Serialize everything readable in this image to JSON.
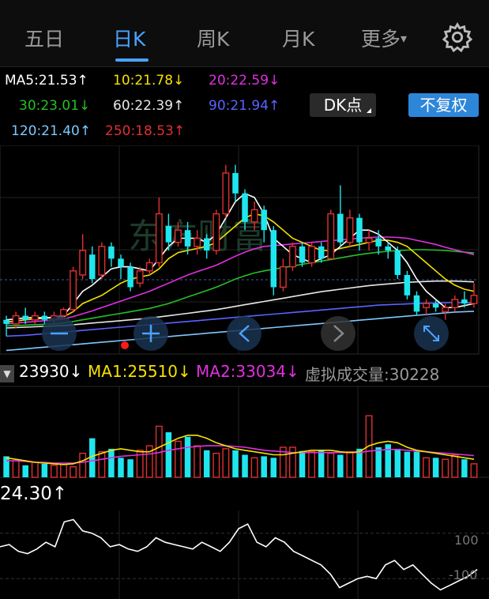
{
  "tabs": [
    {
      "label": "五日",
      "active": false
    },
    {
      "label": "日K",
      "active": true
    },
    {
      "label": "周K",
      "active": false
    },
    {
      "label": "月K",
      "active": false
    },
    {
      "label": "更多",
      "active": false
    }
  ],
  "more_arrow": "▾",
  "ma": {
    "ma5": {
      "text": "MA5:21.53",
      "arrow": "↑",
      "color": "#ffffff"
    },
    "ma10": {
      "text": "10:21.78",
      "arrow": "↓",
      "color": "#f5e200"
    },
    "ma20": {
      "text": "20:22.59",
      "arrow": "↓",
      "color": "#e030e0"
    },
    "ma30": {
      "text": "30:23.01",
      "arrow": "↓",
      "color": "#25c025"
    },
    "ma60": {
      "text": "60:22.39",
      "arrow": "↑",
      "color": "#e8e8e8"
    },
    "ma90": {
      "text": "90:21.94",
      "arrow": "↑",
      "color": "#5a63ff"
    },
    "ma120": {
      "text": "120:21.40",
      "arrow": "↑",
      "color": "#7ec8ff"
    },
    "ma250": {
      "text": "250:18.53",
      "arrow": "↑",
      "color": "#e03030"
    }
  },
  "buttons": {
    "dk_label": "DK点",
    "fuquan_label": "不复权"
  },
  "volume": {
    "vol": "23930",
    "vol_arrow": "↓",
    "ma1": "MA1:25510",
    "ma1_arrow": "↓",
    "ma2": "MA2:33034",
    "ma2_arrow": "↓",
    "virtual": "虚拟成交量:30228"
  },
  "indicator": {
    "value": "24.30",
    "arrow": "↑",
    "level_high": "100",
    "level_low": "-100"
  },
  "watermark": "东方财富",
  "colors": {
    "up": "#e03030",
    "down": "#1fe6ee",
    "accent": "#4aa3ff"
  },
  "chart_data": {
    "type": "candlestick",
    "candles": [
      {
        "o": 22.0,
        "c": 21.9,
        "h": 22.1,
        "l": 21.6,
        "d": "dn"
      },
      {
        "o": 21.9,
        "c": 22.1,
        "h": 22.2,
        "l": 21.8,
        "d": "up"
      },
      {
        "o": 22.1,
        "c": 22.0,
        "h": 22.3,
        "l": 21.9,
        "d": "dn"
      },
      {
        "o": 22.0,
        "c": 22.1,
        "h": 22.2,
        "l": 21.9,
        "d": "up"
      },
      {
        "o": 22.1,
        "c": 22.0,
        "h": 22.2,
        "l": 21.9,
        "d": "dn"
      },
      {
        "o": 22.0,
        "c": 22.1,
        "h": 22.2,
        "l": 21.9,
        "d": "up"
      },
      {
        "o": 22.1,
        "c": 22.25,
        "h": 22.3,
        "l": 22.0,
        "d": "up"
      },
      {
        "o": 22.25,
        "c": 23.2,
        "h": 23.3,
        "l": 22.2,
        "d": "up"
      },
      {
        "o": 23.1,
        "c": 23.7,
        "h": 24.1,
        "l": 23.0,
        "d": "up"
      },
      {
        "o": 23.6,
        "c": 23.0,
        "h": 23.8,
        "l": 22.9,
        "d": "dn"
      },
      {
        "o": 23.1,
        "c": 23.8,
        "h": 23.9,
        "l": 23.0,
        "d": "up"
      },
      {
        "o": 23.8,
        "c": 23.5,
        "h": 23.9,
        "l": 23.3,
        "d": "dn"
      },
      {
        "o": 23.5,
        "c": 23.3,
        "h": 23.6,
        "l": 23.0,
        "d": "dn"
      },
      {
        "o": 23.3,
        "c": 22.8,
        "h": 23.4,
        "l": 22.7,
        "d": "dn"
      },
      {
        "o": 22.9,
        "c": 23.2,
        "h": 23.3,
        "l": 22.8,
        "d": "up"
      },
      {
        "o": 23.2,
        "c": 23.4,
        "h": 23.5,
        "l": 23.1,
        "d": "up"
      },
      {
        "o": 23.4,
        "c": 24.6,
        "h": 25.0,
        "l": 23.3,
        "d": "up"
      },
      {
        "o": 24.3,
        "c": 23.9,
        "h": 24.6,
        "l": 23.7,
        "d": "dn"
      },
      {
        "o": 23.9,
        "c": 24.2,
        "h": 24.4,
        "l": 23.8,
        "d": "up"
      },
      {
        "o": 24.2,
        "c": 23.8,
        "h": 24.4,
        "l": 23.6,
        "d": "dn"
      },
      {
        "o": 23.8,
        "c": 24.0,
        "h": 24.2,
        "l": 23.6,
        "d": "up"
      },
      {
        "o": 24.0,
        "c": 23.7,
        "h": 24.1,
        "l": 23.5,
        "d": "dn"
      },
      {
        "o": 23.7,
        "c": 24.6,
        "h": 24.7,
        "l": 23.6,
        "d": "up"
      },
      {
        "o": 24.6,
        "c": 25.6,
        "h": 25.8,
        "l": 24.5,
        "d": "up"
      },
      {
        "o": 25.6,
        "c": 25.1,
        "h": 25.8,
        "l": 24.9,
        "d": "dn"
      },
      {
        "o": 25.1,
        "c": 24.4,
        "h": 25.2,
        "l": 24.2,
        "d": "dn"
      },
      {
        "o": 24.4,
        "c": 24.7,
        "h": 24.9,
        "l": 24.2,
        "d": "up"
      },
      {
        "o": 24.7,
        "c": 24.2,
        "h": 24.8,
        "l": 23.9,
        "d": "dn"
      },
      {
        "o": 24.2,
        "c": 22.8,
        "h": 24.3,
        "l": 22.6,
        "d": "dn"
      },
      {
        "o": 22.8,
        "c": 23.3,
        "h": 23.5,
        "l": 22.7,
        "d": "up"
      },
      {
        "o": 23.3,
        "c": 23.8,
        "h": 23.9,
        "l": 23.2,
        "d": "up"
      },
      {
        "o": 23.8,
        "c": 23.4,
        "h": 23.9,
        "l": 23.3,
        "d": "dn"
      },
      {
        "o": 23.4,
        "c": 23.8,
        "h": 23.9,
        "l": 23.3,
        "d": "up"
      },
      {
        "o": 23.8,
        "c": 23.5,
        "h": 23.9,
        "l": 23.4,
        "d": "dn"
      },
      {
        "o": 23.5,
        "c": 24.6,
        "h": 24.7,
        "l": 23.5,
        "d": "up"
      },
      {
        "o": 24.6,
        "c": 23.9,
        "h": 25.3,
        "l": 23.8,
        "d": "dn"
      },
      {
        "o": 23.9,
        "c": 24.5,
        "h": 24.7,
        "l": 23.8,
        "d": "up"
      },
      {
        "o": 24.5,
        "c": 23.9,
        "h": 24.6,
        "l": 23.7,
        "d": "dn"
      },
      {
        "o": 23.9,
        "c": 24.0,
        "h": 24.2,
        "l": 23.7,
        "d": "up"
      },
      {
        "o": 24.0,
        "c": 23.8,
        "h": 24.2,
        "l": 23.6,
        "d": "dn"
      },
      {
        "o": 23.8,
        "c": 23.7,
        "h": 23.9,
        "l": 23.5,
        "d": "dn"
      },
      {
        "o": 23.7,
        "c": 23.1,
        "h": 23.8,
        "l": 23.0,
        "d": "dn"
      },
      {
        "o": 23.1,
        "c": 22.6,
        "h": 23.2,
        "l": 22.5,
        "d": "dn"
      },
      {
        "o": 22.6,
        "c": 22.2,
        "h": 22.7,
        "l": 22.1,
        "d": "dn"
      },
      {
        "o": 22.3,
        "c": 22.4,
        "h": 22.5,
        "l": 22.1,
        "d": "up"
      },
      {
        "o": 22.4,
        "c": 22.3,
        "h": 22.5,
        "l": 22.2,
        "d": "dn"
      },
      {
        "o": 22.2,
        "c": 22.3,
        "h": 22.4,
        "l": 22.0,
        "d": "up"
      },
      {
        "o": 22.3,
        "c": 22.5,
        "h": 22.6,
        "l": 22.2,
        "d": "up"
      },
      {
        "o": 22.5,
        "c": 22.4,
        "h": 22.7,
        "l": 22.3,
        "d": "dn"
      },
      {
        "o": 22.4,
        "c": 22.6,
        "h": 22.9,
        "l": 22.3,
        "d": "up"
      }
    ],
    "ylim": [
      21.2,
      26.2
    ],
    "volume": {
      "values": [
        28,
        22,
        16,
        20,
        18,
        16,
        17,
        14,
        32,
        52,
        34,
        38,
        26,
        24,
        36,
        42,
        68,
        60,
        48,
        54,
        42,
        36,
        32,
        38,
        36,
        30,
        26,
        28,
        26,
        40,
        40,
        35,
        34,
        36,
        32,
        30,
        34,
        38,
        82,
        40,
        44,
        38,
        34,
        34,
        26,
        26,
        24,
        30,
        24,
        18
      ],
      "ylim": [
        0,
        120
      ]
    },
    "ma5": [
      22.0,
      22.02,
      22.05,
      22.05,
      22.05,
      22.06,
      22.1,
      22.4,
      22.7,
      22.85,
      23.05,
      23.25,
      23.3,
      23.3,
      23.25,
      23.2,
      23.5,
      23.8,
      24.0,
      24.0,
      24.0,
      23.9,
      24.1,
      24.5,
      24.9,
      25.1,
      25.0,
      24.6,
      24.0,
      23.8,
      23.6,
      23.5,
      23.4,
      23.5,
      23.6,
      23.8,
      24.0,
      24.2,
      24.2,
      24.1,
      23.9,
      23.7,
      23.4,
      23.0,
      22.7,
      22.5,
      22.3,
      22.3,
      22.35,
      22.4
    ],
    "ma10": [
      21.95,
      21.97,
      22.0,
      22.02,
      22.04,
      22.05,
      22.07,
      22.2,
      22.4,
      22.5,
      22.6,
      22.75,
      22.9,
      23.0,
      23.05,
      23.1,
      23.25,
      23.5,
      23.65,
      23.7,
      23.75,
      23.8,
      23.9,
      24.1,
      24.3,
      24.5,
      24.6,
      24.55,
      24.4,
      24.2,
      24.0,
      23.9,
      23.8,
      23.7,
      23.7,
      23.75,
      23.8,
      23.85,
      23.9,
      23.95,
      23.95,
      23.9,
      23.8,
      23.6,
      23.4,
      23.2,
      23.0,
      22.85,
      22.75,
      22.7
    ],
    "ma20": [
      21.9,
      21.92,
      21.94,
      21.96,
      21.98,
      22.0,
      22.02,
      22.08,
      22.15,
      22.22,
      22.3,
      22.38,
      22.46,
      22.54,
      22.62,
      22.7,
      22.8,
      22.9,
      23.0,
      23.1,
      23.18,
      23.26,
      23.34,
      23.45,
      23.56,
      23.66,
      23.74,
      23.8,
      23.82,
      23.84,
      23.86,
      23.88,
      23.9,
      23.92,
      23.94,
      23.96,
      23.98,
      24.0,
      24.02,
      24.03,
      24.03,
      24.02,
      24.0,
      23.95,
      23.9,
      23.85,
      23.78,
      23.72,
      23.66,
      23.6
    ],
    "ma30": [
      21.85,
      21.86,
      21.87,
      21.88,
      21.89,
      21.9,
      21.92,
      21.96,
      22.0,
      22.04,
      22.08,
      22.12,
      22.16,
      22.2,
      22.24,
      22.28,
      22.34,
      22.4,
      22.48,
      22.56,
      22.64,
      22.72,
      22.8,
      22.9,
      23.0,
      23.08,
      23.15,
      23.2,
      23.24,
      23.28,
      23.32,
      23.36,
      23.4,
      23.44,
      23.48,
      23.52,
      23.56,
      23.6,
      23.63,
      23.66,
      23.68,
      23.7,
      23.71,
      23.72,
      23.72,
      23.71,
      23.7,
      23.68,
      23.66,
      23.64
    ],
    "ma60": [
      21.8,
      21.81,
      21.82,
      21.83,
      21.84,
      21.85,
      21.86,
      21.88,
      21.9,
      21.92,
      21.94,
      21.96,
      21.98,
      22.0,
      22.02,
      22.04,
      22.07,
      22.1,
      22.13,
      22.16,
      22.19,
      22.22,
      22.25,
      22.29,
      22.33,
      22.37,
      22.41,
      22.45,
      22.49,
      22.53,
      22.57,
      22.61,
      22.65,
      22.69,
      22.72,
      22.75,
      22.78,
      22.81,
      22.84,
      22.86,
      22.88,
      22.9,
      22.92,
      22.93,
      22.94,
      22.95,
      22.95,
      22.95,
      22.94,
      22.93
    ],
    "ma90": [
      21.6,
      21.61,
      21.62,
      21.64,
      21.66,
      21.68,
      21.7,
      21.72,
      21.74,
      21.76,
      21.78,
      21.8,
      21.82,
      21.84,
      21.86,
      21.88,
      21.9,
      21.92,
      21.94,
      21.96,
      21.98,
      22.0,
      22.02,
      22.04,
      22.06,
      22.08,
      22.1,
      22.12,
      22.14,
      22.16,
      22.18,
      22.2,
      22.22,
      22.24,
      22.26,
      22.28,
      22.3,
      22.32,
      22.34,
      22.36,
      22.37,
      22.38,
      22.39,
      22.4,
      22.41,
      22.41,
      22.42,
      22.42,
      22.42,
      22.42
    ],
    "ma120": [
      21.25,
      21.27,
      21.29,
      21.31,
      21.33,
      21.35,
      21.37,
      21.39,
      21.41,
      21.43,
      21.45,
      21.47,
      21.49,
      21.51,
      21.53,
      21.55,
      21.57,
      21.59,
      21.61,
      21.63,
      21.65,
      21.67,
      21.69,
      21.71,
      21.73,
      21.75,
      21.77,
      21.79,
      21.81,
      21.83,
      21.85,
      21.87,
      21.89,
      21.91,
      21.93,
      21.95,
      21.97,
      21.99,
      22.01,
      22.03,
      22.05,
      22.07,
      22.09,
      22.11,
      22.13,
      22.15,
      22.17,
      22.19,
      22.2,
      22.21
    ],
    "ma250": [
      20.3,
      20.31,
      20.32,
      20.33,
      20.34,
      20.35,
      20.36,
      20.37,
      20.38,
      20.39,
      20.4,
      20.41,
      20.42,
      20.43,
      20.44,
      20.45,
      20.46,
      20.47,
      20.48,
      20.49,
      20.5,
      20.51,
      20.52,
      20.53,
      20.54,
      20.55,
      20.56,
      20.57,
      20.58,
      20.59,
      20.6,
      20.61,
      20.62,
      20.63,
      20.64,
      20.65,
      20.66,
      20.67,
      20.68,
      20.69,
      20.7,
      20.71,
      20.72,
      20.73,
      20.74,
      20.75,
      20.76,
      20.77,
      20.78,
      20.79
    ],
    "vol_ma1": [
      26,
      24,
      22,
      20,
      19,
      18,
      17,
      18,
      22,
      28,
      32,
      36,
      38,
      36,
      34,
      34,
      40,
      46,
      52,
      56,
      56,
      52,
      46,
      42,
      38,
      36,
      34,
      32,
      30,
      30,
      32,
      34,
      36,
      36,
      36,
      34,
      33,
      34,
      42,
      46,
      48,
      46,
      40,
      36,
      34,
      32,
      30,
      28,
      26,
      24
    ],
    "vol_ma2": [
      22,
      22,
      21,
      20,
      20,
      19,
      19,
      19,
      20,
      22,
      24,
      26,
      28,
      29,
      30,
      31,
      33,
      36,
      38,
      40,
      41,
      42,
      42,
      42,
      41,
      40,
      38,
      36,
      35,
      34,
      33,
      33,
      33,
      33,
      33,
      33,
      33,
      33,
      35,
      36,
      37,
      37,
      36,
      35,
      34,
      33,
      32,
      31,
      30,
      29
    ],
    "indicator_values": [
      40,
      50,
      20,
      10,
      30,
      60,
      40,
      150,
      160,
      110,
      100,
      80,
      40,
      50,
      30,
      20,
      40,
      80,
      60,
      50,
      40,
      30,
      60,
      40,
      20,
      60,
      120,
      140,
      60,
      40,
      80,
      60,
      20,
      0,
      -20,
      -40,
      -80,
      -140,
      -120,
      -100,
      -90,
      -100,
      -40,
      -20,
      -60,
      -40,
      -80,
      -120,
      -150,
      -130,
      -110,
      -90,
      -60
    ],
    "indicator_ylim": [
      -190,
      200
    ]
  }
}
